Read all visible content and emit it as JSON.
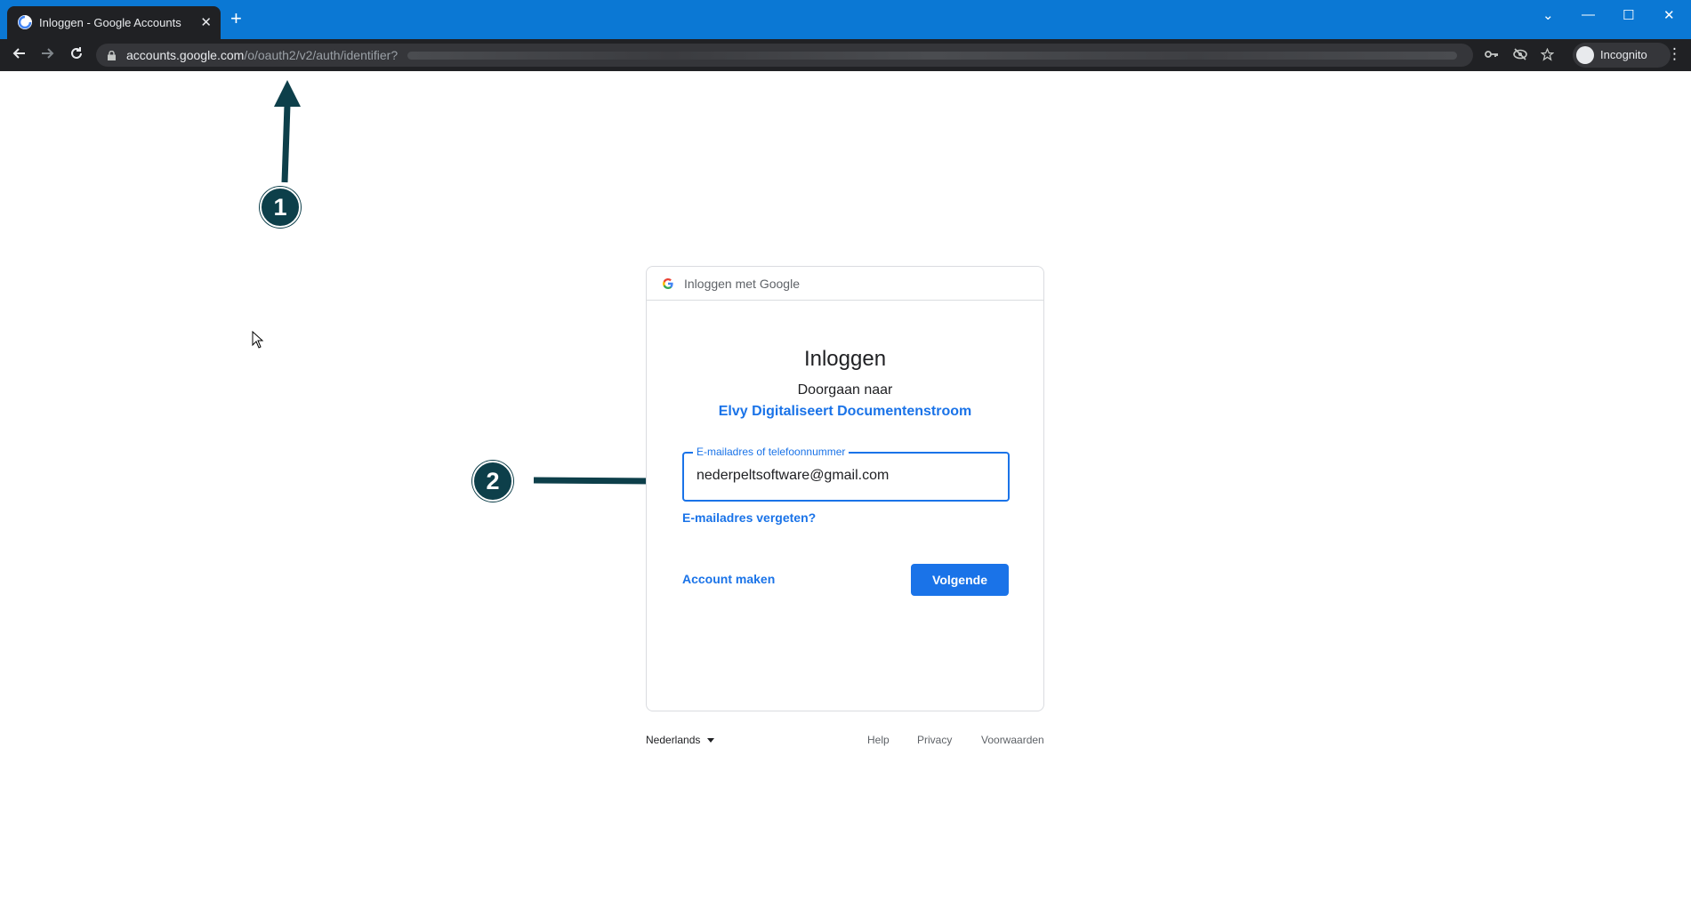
{
  "browser": {
    "tab_title": "Inloggen - Google Accounts",
    "tab_close": "✕",
    "new_tab": "+",
    "url_host": "accounts.google.com",
    "url_path": "/o/oauth2/v2/auth/identifier?",
    "profile_label": "Incognito",
    "window_controls": {
      "minimize": "—",
      "maximize": "☐",
      "close": "✕",
      "tab_search": "⌄"
    }
  },
  "annotations": {
    "callout_1": "1",
    "callout_2": "2",
    "color": "#0d3f4a"
  },
  "card": {
    "header": "Inloggen met Google",
    "title": "Inloggen",
    "subtitle": "Doorgaan naar",
    "app_name": "Elvy Digitaliseert Documentenstroom",
    "field_label": "E-mailadres of telefoonnummer",
    "field_value": "nederpeltsoftware@gmail.com",
    "forgot_link": "E-mailadres vergeten?",
    "create_link": "Account maken",
    "next_button": "Volgende"
  },
  "footer": {
    "language": "Nederlands",
    "help": "Help",
    "privacy": "Privacy",
    "terms": "Voorwaarden"
  },
  "colors": {
    "accent": "#1a73e8",
    "titlebar": "#0b78d4",
    "chrome_dark": "#202124"
  }
}
